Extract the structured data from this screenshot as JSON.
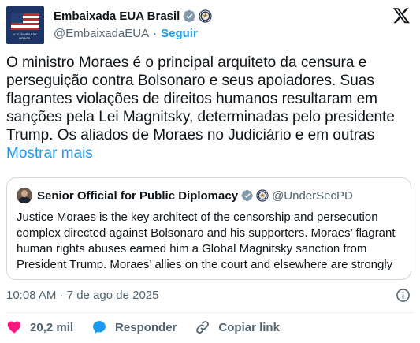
{
  "author": {
    "display_name": "Embaixada EUA Brasil",
    "handle": "@EmbaixadaEUA",
    "separator": "·",
    "follow_label": "Seguir",
    "avatar_caption_line1": "U.S. EMBASSY",
    "avatar_caption_line2": "BRASIL",
    "verified_color": "#829aab",
    "avatar_color": "#1d3466"
  },
  "tweet": {
    "text": "O ministro Moraes é o principal arquiteto da censura e perseguição contra Bolsonaro e seus apoiadores. Suas flagrantes violações de direitos humanos resultaram em sanções pela Lei Magnitsky, determinadas pelo presidente Trump. Os aliados de Moraes no Judiciário e em outras",
    "show_more_label": "Mostrar mais",
    "timestamp": "10:08 AM · 7 de ago de 2025"
  },
  "quote": {
    "display_name": "Senior Official for Public Diplomacy",
    "handle": "@UnderSecPD",
    "text": "Justice Moraes is the key architect of the censorship and persecution complex directed against Bolsonaro and his supporters. Moraes’ flagrant human rights abuses earned him a Global Magnitsky sanction from President Trump. Moraes’ allies on the court and elsewhere are strongly"
  },
  "actions": {
    "likes_count": "20,2 mil",
    "reply_label": "Responder",
    "copy_link_label": "Copiar link"
  },
  "colors": {
    "accent": "#1d9bf0",
    "like": "#f91880",
    "reply": "#1d9bf0",
    "text_secondary": "#536471",
    "border": "#cfd9de"
  },
  "icons": {
    "verified": "verified-badge-icon",
    "seal": "government-seal-icon",
    "brand": "x-logo-icon",
    "info": "info-icon",
    "like": "heart-icon",
    "reply": "speech-bubble-icon",
    "copy": "link-icon"
  }
}
